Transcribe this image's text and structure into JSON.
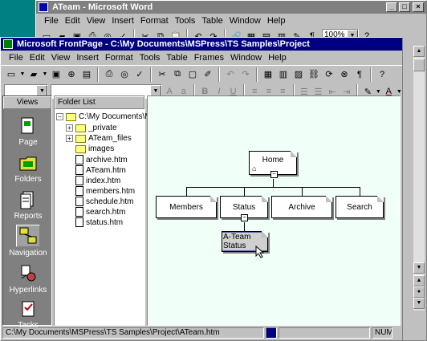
{
  "word_window": {
    "title": "ATeam - Microsoft Word",
    "menus": [
      "File",
      "Edit",
      "View",
      "Insert",
      "Format",
      "Tools",
      "Table",
      "Window",
      "Help"
    ],
    "zoom": "100%"
  },
  "fp_window": {
    "title": "Microsoft FrontPage - C:\\My Documents\\MSPress\\TS Samples\\Project",
    "menus": [
      "File",
      "Edit",
      "View",
      "Insert",
      "Format",
      "Tools",
      "Table",
      "Frames",
      "Window",
      "Help"
    ]
  },
  "views": {
    "header": "Views",
    "items": [
      {
        "label": "Page",
        "icon": "page-view-icon"
      },
      {
        "label": "Folders",
        "icon": "folders-view-icon"
      },
      {
        "label": "Reports",
        "icon": "reports-view-icon"
      },
      {
        "label": "Navigation",
        "icon": "navigation-view-icon"
      },
      {
        "label": "Hyperlinks",
        "icon": "hyperlinks-view-icon"
      },
      {
        "label": "Tasks",
        "icon": "tasks-view-icon"
      }
    ]
  },
  "folder_list": {
    "header": "Folder List",
    "root": "C:\\My Documents\\MSP",
    "folders": [
      "_private",
      "ATeam_files",
      "images"
    ],
    "files": [
      "archive.htm",
      "ATeam.htm",
      "index.htm",
      "members.htm",
      "schedule.htm",
      "search.htm",
      "status.htm"
    ]
  },
  "navigation": {
    "home": "Home",
    "children": [
      "Members",
      "Status",
      "Archive",
      "Search"
    ],
    "selected": "A-Team Status"
  },
  "statusbar": {
    "path": "C:\\My Documents\\MSPress\\TS Samples\\Project\\ATeam.htm",
    "mode": "NUM"
  },
  "colors": {
    "titlebar_active": "#000080",
    "titlebar_inactive": "#808080",
    "views_bg": "#808080",
    "nav_bg": "#f0fff8",
    "selected_node": "#6060a0"
  }
}
